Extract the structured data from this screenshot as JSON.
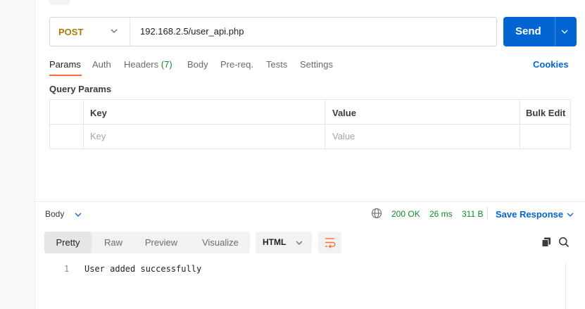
{
  "request": {
    "method": "POST",
    "url": "192.168.2.5/user_api.php",
    "send_label": "Send"
  },
  "tabs": [
    {
      "label": "Params"
    },
    {
      "label": "Auth"
    },
    {
      "label": "Headers",
      "count": "(7)"
    },
    {
      "label": "Body"
    },
    {
      "label": "Pre-req."
    },
    {
      "label": "Tests"
    },
    {
      "label": "Settings"
    }
  ],
  "cookies_label": "Cookies",
  "query_params": {
    "title": "Query Params",
    "col_key": "Key",
    "col_value": "Value",
    "bulk_edit": "Bulk Edit",
    "key_placeholder": "Key",
    "value_placeholder": "Value"
  },
  "response": {
    "body_label": "Body",
    "status": "200 OK",
    "time": "26 ms",
    "size": "311 B",
    "save_label": "Save Response",
    "view_tabs": [
      "Pretty",
      "Raw",
      "Preview",
      "Visualize"
    ],
    "format": "HTML",
    "lines": [
      {
        "number": "1",
        "text": "User added successfully"
      }
    ]
  },
  "colors": {
    "accent_blue": "#0265d2",
    "method_post": "#ad7a03",
    "active_tab_underline": "#ff6c37",
    "status_green": "#0f8a2e"
  },
  "icons": {
    "method_dropdown": "chevron-down-icon",
    "send_dropdown": "chevron-down-icon",
    "network": "globe-icon",
    "wrap": "wrap-lines-icon",
    "copy": "copy-icon",
    "search": "search-icon"
  }
}
